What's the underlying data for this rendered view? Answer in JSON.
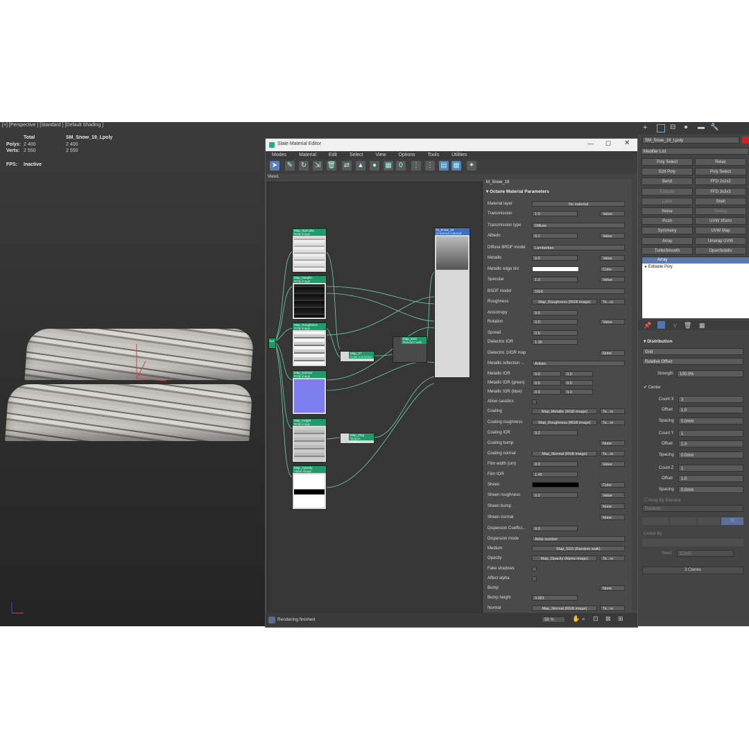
{
  "viewport": {
    "label": "[+] [Perspective ] [Standard ] [Default Shading ]",
    "stats_total": "Total",
    "stats_object": "SM_Snow_19_Lpoly",
    "polys_label": "Polys:",
    "polys_total": "2 400",
    "polys_object": "2 400",
    "verts_label": "Verts:",
    "verts_total": "2 550",
    "verts_object": "2 550",
    "fps_label": "FPS:",
    "fps_value": "Inactive"
  },
  "slate": {
    "title": "Slate Material Editor",
    "menu": [
      "Modes",
      "Material",
      "Edit",
      "Select",
      "View",
      "Options",
      "Tools",
      "Utilities"
    ],
    "view_tab": "View1",
    "status": "Rendering finished",
    "zoom": "56 %",
    "nodes": [
      {
        "name": "Map_Specular",
        "sub": "RGB image"
      },
      {
        "name": "Map_Metallic",
        "sub": "RGB image"
      },
      {
        "name": "Map_Roughness",
        "sub": "RGB image"
      },
      {
        "name": "Map_Normal",
        "sub": "RGB image"
      },
      {
        "name": "Map_Height",
        "sub": "RGB image"
      },
      {
        "name": "Map_Opacity",
        "sub": "Alpha image"
      },
      {
        "name": "Map_37",
        "sub": "Color correction"
      },
      {
        "name": "Map_Disp",
        "sub": "Texture displac..."
      },
      {
        "name": "Map_SSS",
        "sub": "Random walk"
      }
    ],
    "material_node": {
      "name": "M_Snow_19",
      "sub": "Universal material"
    },
    "output_node": "Sout"
  },
  "params": {
    "material_name": "M_Snow_19",
    "section": "Octane Material Parameters",
    "rows": [
      {
        "label": "Material layer",
        "value": "No material",
        "kind": "btn"
      },
      {
        "label": "Transmission",
        "value": "1.0",
        "extra": "Value"
      },
      {
        "label": "Transmission type",
        "value": "Diffuse",
        "kind": "dd"
      },
      {
        "label": "Albedo",
        "value": "0.1",
        "extra": "Value"
      },
      {
        "label": "Diffuse BRDF model",
        "value": "Lambertian",
        "kind": "dd"
      },
      {
        "label": "Metallic",
        "value": "0.0",
        "extra": "Value"
      },
      {
        "label": "Metallic edge tint",
        "value": "",
        "kind": "color-white",
        "extra": "Color"
      },
      {
        "label": "Specular",
        "value": "1.0",
        "extra": "Value"
      },
      {
        "label": "BSDF model",
        "value": "GGX",
        "kind": "dd"
      },
      {
        "label": "Roughness",
        "value": "Map_Roughness (RGB image)",
        "kind": "btn",
        "extra": "Te...re"
      },
      {
        "label": "Anisotropy",
        "value": "0.0"
      },
      {
        "label": "Rotation",
        "value": "0.0",
        "extra": "Value"
      },
      {
        "label": "Spread",
        "value": "0.5"
      },
      {
        "label": "Dielectric IOR",
        "value": "1.35"
      },
      {
        "label": "Dielectric 1/IOR map",
        "value": "",
        "extra": "None"
      },
      {
        "label": "Metallic reflection ...",
        "value": "Artistic",
        "kind": "dd"
      },
      {
        "label": "Metallic IOR",
        "value": "0.0",
        "value2": "0.0"
      },
      {
        "label": "Metallic IOR (green)",
        "value": "0.0",
        "value2": "0.0"
      },
      {
        "label": "Metallic IOR (blue)",
        "value": "0.0",
        "value2": "0.0"
      },
      {
        "label": "Allow caustics",
        "value": "",
        "kind": "check"
      },
      {
        "label": "Coating",
        "value": "Map_Metallic (RGB image)",
        "kind": "btn",
        "extra": "Te...re"
      },
      {
        "label": "Coating roughness",
        "value": "Map_Roughness (RGB image)",
        "kind": "btn",
        "extra": "Te...re"
      },
      {
        "label": "Coating IOR",
        "value": "3.2"
      },
      {
        "label": "Coating bump",
        "value": "",
        "extra": "None"
      },
      {
        "label": "Coating normal",
        "value": "Map_Normal (RGB image)",
        "kind": "btn",
        "extra": "Te...re"
      },
      {
        "label": "Film width (um)",
        "value": "0.0",
        "extra": "Value"
      },
      {
        "label": "Film IOR",
        "value": "1.45"
      },
      {
        "label": "Sheen",
        "value": "",
        "kind": "color-black",
        "extra": "Color"
      },
      {
        "label": "Sheen roughness",
        "value": "0.2",
        "extra": "Value"
      },
      {
        "label": "Sheen bump",
        "value": "",
        "extra": "None"
      },
      {
        "label": "Sheen normal",
        "value": "",
        "extra": "None"
      },
      {
        "label": "Dispersion Coeffici...",
        "value": "0.0"
      },
      {
        "label": "Dispersion mode",
        "value": "Abbe number",
        "kind": "dd"
      },
      {
        "label": "Medium",
        "value": "Map_SSS (Random walk)",
        "kind": "btn"
      },
      {
        "label": "Opacity",
        "value": "Map_Opacity (Alpha image)",
        "kind": "btn",
        "extra": "Te...re"
      },
      {
        "label": "Fake shadows",
        "value": "",
        "kind": "check"
      },
      {
        "label": "Affect alpha",
        "value": "",
        "kind": "check"
      },
      {
        "label": "Bump",
        "value": "",
        "extra": "None"
      },
      {
        "label": "Bump height",
        "value": "0.001"
      },
      {
        "label": "Normal",
        "value": "Map_Normal (RGB image)",
        "kind": "btn",
        "extra": "Te...re"
      }
    ]
  },
  "command_panel": {
    "object_name": "SM_Snow_19_Lpoly",
    "modifier_list": "Modifier List",
    "buttons": [
      [
        "Poly Select",
        "Relax"
      ],
      [
        "Edit Poly",
        "Poly Select"
      ],
      [
        "Bend",
        "FFD 2x2x2"
      ],
      [
        "Extrude",
        "FFD 3x3x3"
      ],
      [
        "Lathe",
        "Shell"
      ],
      [
        "Noise",
        "Sweep"
      ],
      [
        "Push",
        "UVW Xform"
      ],
      [
        "Symmetry",
        "UVW Map"
      ],
      [
        "Array",
        "Unwrap UVW"
      ],
      [
        "TurboSmooth",
        "OpenSubdiv"
      ]
    ],
    "stack": [
      "Array",
      "Editable Poly"
    ],
    "distribution_title": "Distribution",
    "distribution_type": "Grid",
    "offset_mode": "Relative Offset",
    "strength_label": "Strength",
    "strength": "100.0%",
    "center_label": "Center",
    "count_x_label": "Count X",
    "count_x": "3",
    "offset_x_label": "Offset",
    "offset_x": "1.0",
    "spacing_x_label": "Spacing",
    "spacing_x": "0.0mm",
    "count_y_label": "Count Y",
    "count_y": "1",
    "offset_y_label": "Offset",
    "offset_y": "1.0",
    "spacing_y_label": "Spacing",
    "spacing_y": "0.0mm",
    "count_z_label": "Count Z",
    "count_z": "1",
    "offset_z_label": "Offset",
    "offset_z": "1.0",
    "spacing_z_label": "Spacing",
    "spacing_z": "0.0mm",
    "array_by_element": "Array By Element",
    "random_label": "Random",
    "id_label": "ID",
    "center_by": "Center By",
    "seed_label": "Seed",
    "seed": "12345",
    "clones": "3 Clones"
  }
}
